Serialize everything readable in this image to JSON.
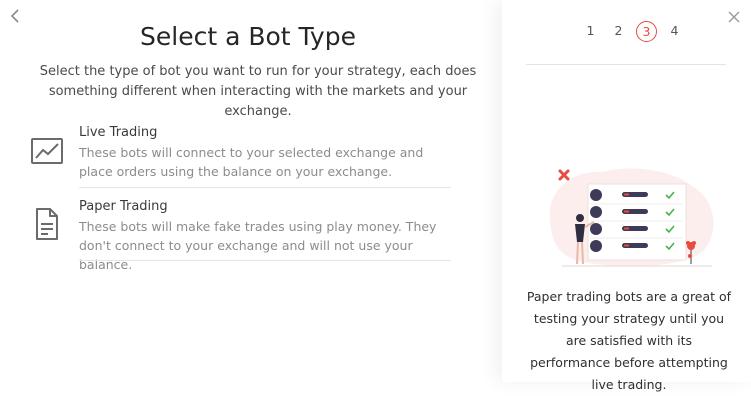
{
  "main": {
    "title": "Select a Bot Type",
    "subtitle": "Select the type of bot you want to run for your strategy, each does something different when interacting with the markets and your exchange.",
    "options": [
      {
        "name": "Live Trading",
        "description": "These bots will connect to your selected exchange and place orders using the balance on your exchange.",
        "icon": "line-chart-icon"
      },
      {
        "name": "Paper Trading",
        "description": "These bots will make fake trades using play money. They don't connect to your exchange and will not use your balance.",
        "icon": "document-icon"
      }
    ]
  },
  "sidebar": {
    "steps": [
      "1",
      "2",
      "3",
      "4"
    ],
    "active_step": "3",
    "help_text": "Paper trading bots are a great of testing your strategy until you are satisfied with its performance before attempting live trading."
  },
  "colors": {
    "accent": "#e74c3c",
    "check": "#4caf50",
    "dark_dot": "#3d3b57",
    "illustration_bg": "#fdeeee"
  }
}
